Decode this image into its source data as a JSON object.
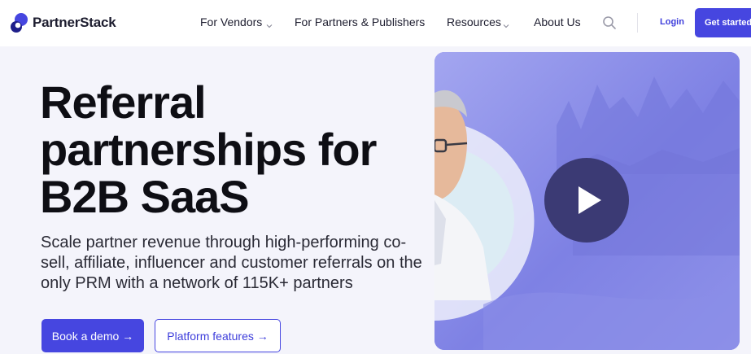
{
  "brand": {
    "name": "PartnerStack"
  },
  "nav": {
    "items": [
      {
        "label": "For Vendors",
        "has_dropdown": true
      },
      {
        "label": "For Partners & Publishers",
        "has_dropdown": false
      },
      {
        "label": "Resources",
        "has_dropdown": true
      },
      {
        "label": "About Us",
        "has_dropdown": false
      }
    ],
    "search_icon": "search-icon",
    "login_label": "Login",
    "cta_label": "Get started"
  },
  "hero": {
    "headline_lines": [
      "Referral",
      "partnerships for",
      "B2B SaaS"
    ],
    "subheadline": "Scale partner revenue through high-performing co-sell, affiliate, influencer and customer referrals on the only PRM with a network of 115K+ partners",
    "primary_button": "Book a demo →",
    "secondary_button": "Platform features →"
  },
  "video": {
    "play_icon": "play-icon"
  },
  "colors": {
    "accent": "#4646e0",
    "hero_bg": "#f4f4fb",
    "video_bg": "#7f82e6",
    "play_button": "#3b3a74",
    "teal": "#73d8c5"
  }
}
